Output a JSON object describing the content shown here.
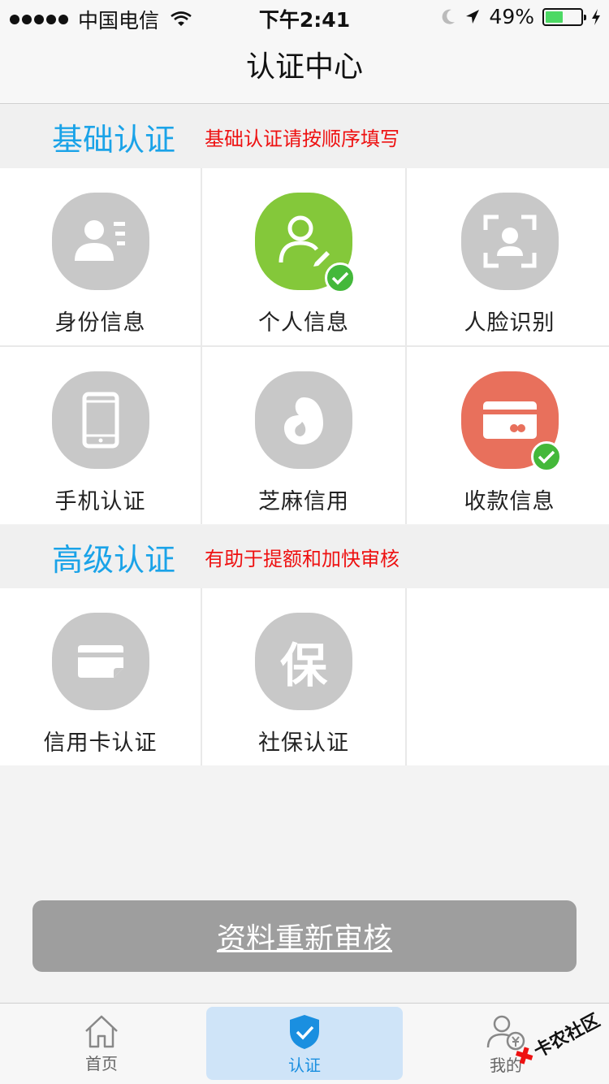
{
  "status_bar": {
    "carrier": "中国电信",
    "time": "下午2:41",
    "battery_percent": "49%",
    "battery_level": 0.49
  },
  "nav": {
    "title": "认证中心"
  },
  "basic": {
    "title": "基础认证",
    "note": "基础认证请按顺序填写",
    "items": [
      {
        "label": "身份信息",
        "icon": "id-card-icon",
        "verified": false
      },
      {
        "label": "个人信息",
        "icon": "person-edit-icon",
        "verified": true
      },
      {
        "label": "人脸识别",
        "icon": "face-scan-icon",
        "verified": false
      },
      {
        "label": "手机认证",
        "icon": "phone-icon",
        "verified": false
      },
      {
        "label": "芝麻信用",
        "icon": "sesame-icon",
        "verified": false
      },
      {
        "label": "收款信息",
        "icon": "bank-card-icon",
        "verified": true
      }
    ]
  },
  "advanced": {
    "title": "高级认证",
    "note": "有助于提额和加快审核",
    "items": [
      {
        "label": "信用卡认证",
        "icon": "credit-card-icon"
      },
      {
        "label": "社保认证",
        "icon_text": "保"
      }
    ]
  },
  "button": {
    "label": "资料重新审核"
  },
  "tabs": [
    {
      "label": "首页",
      "icon": "home-icon"
    },
    {
      "label": "认证",
      "icon": "shield-check-icon",
      "active": true
    },
    {
      "label": "我的",
      "icon": "user-yen-icon"
    }
  ],
  "watermark": {
    "text": "卡农社区"
  },
  "colors": {
    "accent": "#1aa3e8",
    "note_red": "#ee1111",
    "green": "#84c83a",
    "red": "#e8705c",
    "gray_icon": "#c8c8c8",
    "check": "#44b83a"
  }
}
